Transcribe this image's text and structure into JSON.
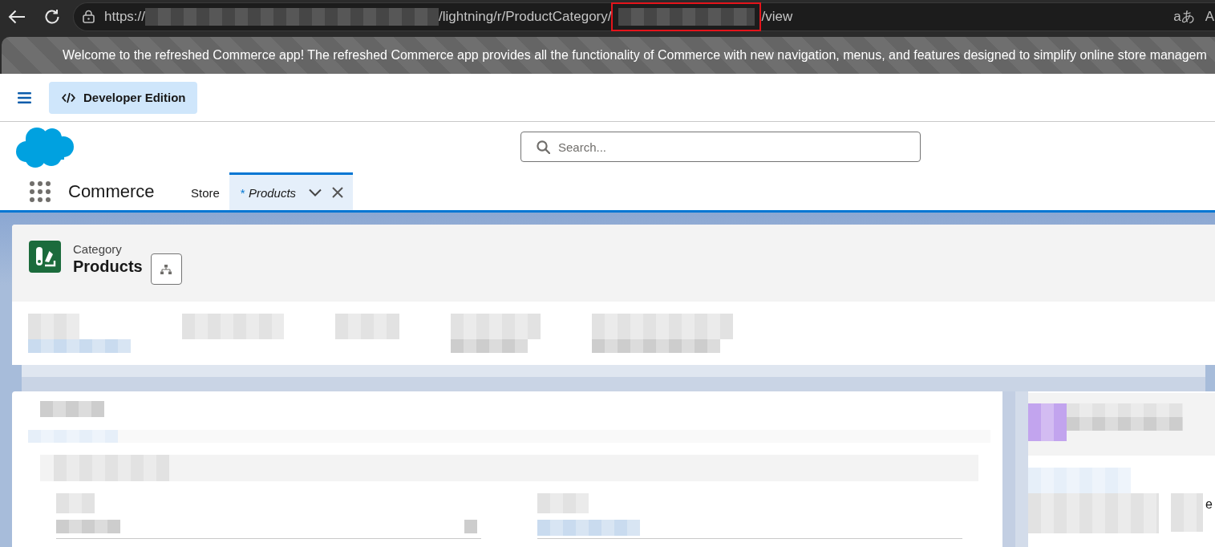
{
  "browser": {
    "url": {
      "scheme": "https://",
      "path": "/lightning/r/ProductCategory/",
      "suffix": "/view",
      "id_highlighted": true
    },
    "translate_glyph": "aあ",
    "edge_glyph": "A"
  },
  "banner": {
    "message": "Welcome to the refreshed Commerce app! The refreshed Commerce app provides all the functionality of Commerce with new navigation, menus, and features designed to simplify online store managem"
  },
  "header": {
    "edition_button": "Developer Edition"
  },
  "search": {
    "placeholder": "Search..."
  },
  "nav": {
    "app_name": "Commerce",
    "tabs": [
      {
        "label": "Store",
        "selected": false,
        "closable": false
      },
      {
        "label": "Products",
        "marker": "*",
        "selected": true,
        "closable": true
      }
    ]
  },
  "record": {
    "object_label": "Category",
    "title": "Products",
    "highlight_fields": [
      {
        "kind": "link"
      },
      {
        "kind": "text"
      },
      {
        "kind": "text"
      },
      {
        "kind": "long_text"
      },
      {
        "kind": "long_text"
      }
    ]
  },
  "detail_card": {
    "fields": [
      {
        "kind": "text"
      },
      {
        "kind": "link"
      }
    ]
  },
  "side_panel": {
    "cut_text": "e"
  }
}
